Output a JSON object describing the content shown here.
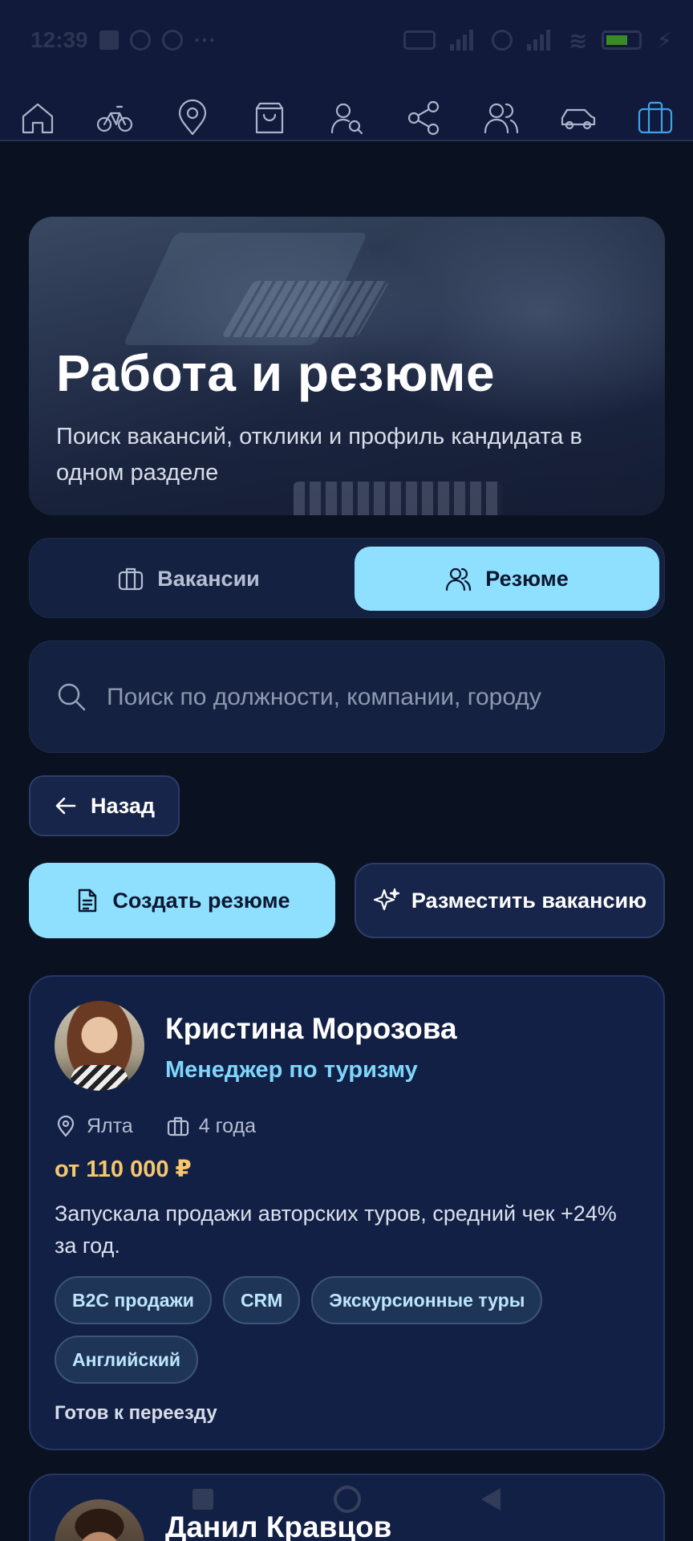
{
  "status_bar": {
    "time": "12:39",
    "battery": "5"
  },
  "top_nav": {
    "icons": [
      "home-icon",
      "bicycle-icon",
      "map-pin-icon",
      "shopping-bag-icon",
      "user-search-icon",
      "share-icon",
      "users-icon",
      "car-icon",
      "briefcase-icon"
    ],
    "active": "briefcase-icon",
    "active_color": "#3aa3ec"
  },
  "hero": {
    "title": "Работа и резюме",
    "subtitle": "Поиск вакансий, отклики и профиль кандидата в одном разделе"
  },
  "tabs": {
    "vacancies_label": "Вакансии",
    "resumes_label": "Резюме",
    "selected": "Резюме"
  },
  "search": {
    "placeholder": "Поиск по должности, компании, городу",
    "value": ""
  },
  "back_label": "Назад",
  "actions": {
    "create_resume": "Создать резюме",
    "post_vacancy": "Разместить вакансию"
  },
  "colors": {
    "accent": "#8fe0ff",
    "background": "#0a1120",
    "card": "#132046",
    "salary": "#f6c86a",
    "role": "#7fd6fb"
  },
  "resumes": [
    {
      "name": "Кристина Морозова",
      "role": "Менеджер по туризму",
      "city": "Ялта",
      "experience": "4 года",
      "salary": "от 110 000 ₽",
      "description": "Запускала продажи авторских туров, средний чек +24% за год.",
      "skills": [
        "B2C продажи",
        "CRM",
        "Экскурсионные туры",
        "Английский"
      ],
      "relocation": "Готов к переезду"
    },
    {
      "name": "Данил Кравцов"
    }
  ]
}
